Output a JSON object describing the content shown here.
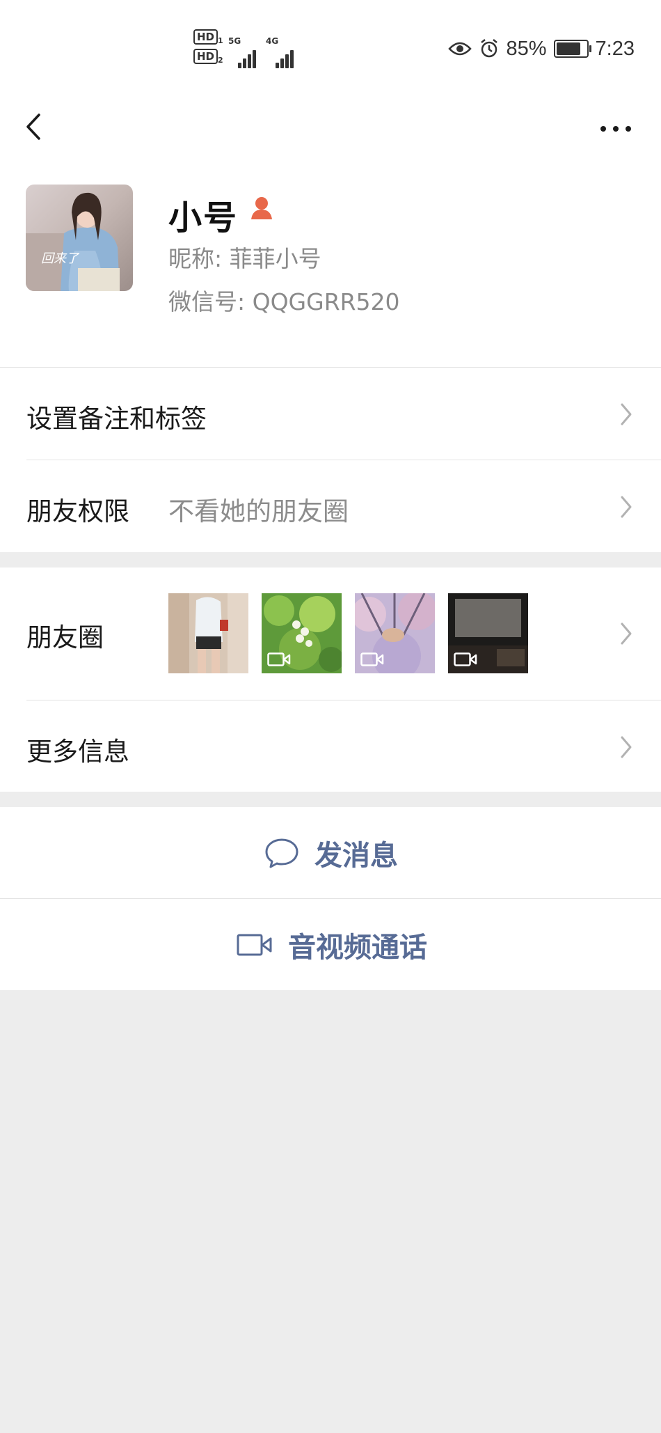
{
  "status_bar": {
    "hd1": "HD",
    "hd2": "HD",
    "net1": "5G",
    "net2": "4G",
    "battery_percent": "85%",
    "battery_level": 0.85,
    "time": "7:23"
  },
  "profile": {
    "name": "小号",
    "nickname": "昵称:  菲菲小号",
    "wechat_id": "微信号:  QQGGRR520",
    "avatar_caption": "回来了"
  },
  "rows": {
    "remark_tags": "设置备注和标签",
    "friend_permission_label": "朋友权限",
    "friend_permission_value": "不看她的朋友圈",
    "moments_label": "朋友圈",
    "more_info": "更多信息"
  },
  "actions": {
    "send_message": "发消息",
    "av_call": "音视频通话"
  },
  "colors": {
    "accent": "#576b95",
    "person_icon": "#e8684a",
    "background": "#ededed"
  }
}
